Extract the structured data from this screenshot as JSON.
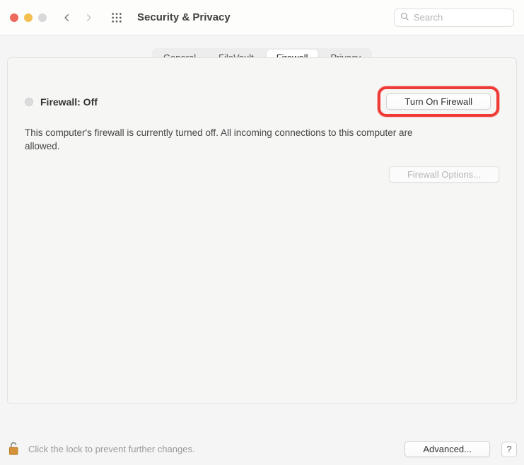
{
  "toolbar": {
    "title": "Security & Privacy",
    "search_placeholder": "Search"
  },
  "tabs": [
    {
      "label": "General"
    },
    {
      "label": "FileVault"
    },
    {
      "label": "Firewall"
    },
    {
      "label": "Privacy"
    }
  ],
  "firewall": {
    "status_label": "Firewall: Off",
    "turn_on_label": "Turn On Firewall",
    "description": "This computer's firewall is currently turned off. All incoming connections to this computer are allowed.",
    "options_label": "Firewall Options..."
  },
  "footer": {
    "lock_text": "Click the lock to prevent further changes.",
    "advanced_label": "Advanced...",
    "help_label": "?"
  }
}
